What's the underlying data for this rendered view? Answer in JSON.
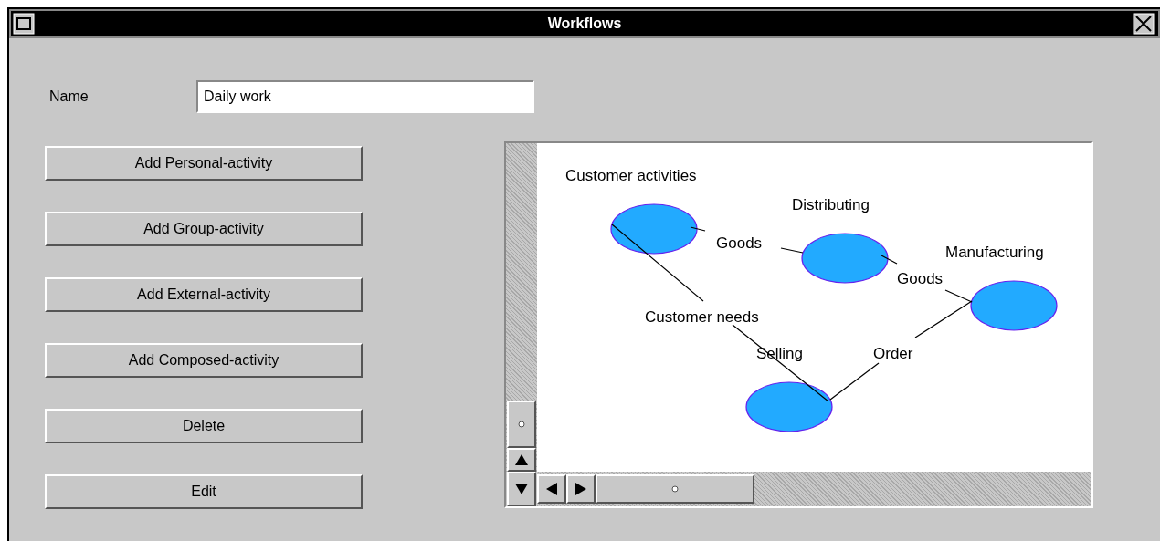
{
  "window": {
    "title": "Workflows"
  },
  "name_field": {
    "label": "Name",
    "value": "Daily work"
  },
  "buttons": [
    "Add Personal-activity",
    "Add Group-activity",
    "Add External-activity",
    "Add Composed-activity",
    "Delete",
    "Edit"
  ],
  "diagram": {
    "nodes": [
      {
        "label": "Customer activities"
      },
      {
        "label": "Distributing"
      },
      {
        "label": "Manufacturing"
      },
      {
        "label": "Selling"
      }
    ],
    "edges": [
      {
        "label": "Goods"
      },
      {
        "label": "Goods"
      },
      {
        "label": "Customer needs"
      },
      {
        "label": "Order"
      }
    ]
  }
}
